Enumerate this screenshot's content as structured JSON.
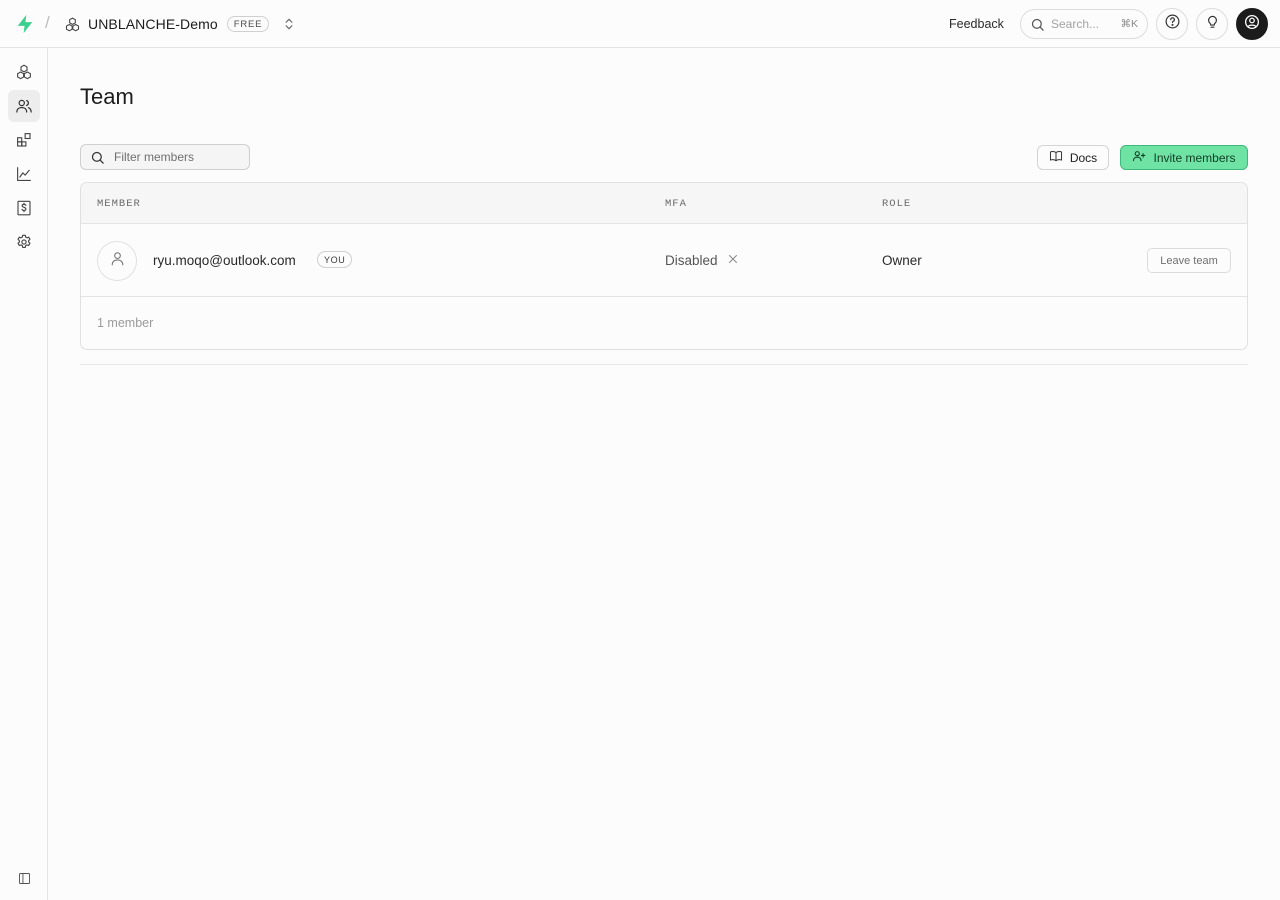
{
  "header": {
    "org_name": "UNBLANCHE-Demo",
    "plan_badge": "FREE",
    "feedback_label": "Feedback",
    "search_placeholder": "Search...",
    "search_shortcut": "⌘K",
    "icons": [
      "brand-logo-icon",
      "org-icon",
      "switch-org-icon",
      "search-icon",
      "help-icon",
      "lightbulb-icon",
      "user-avatar-icon"
    ]
  },
  "sidebar": {
    "items": [
      {
        "name": "projects",
        "icon": "boxes-icon",
        "active": false
      },
      {
        "name": "team",
        "icon": "users-icon",
        "active": true
      },
      {
        "name": "integrations",
        "icon": "blocks-icon",
        "active": false
      },
      {
        "name": "usage",
        "icon": "chart-icon",
        "active": false
      },
      {
        "name": "billing",
        "icon": "billing-icon",
        "active": false
      },
      {
        "name": "settings",
        "icon": "gear-icon",
        "active": false
      }
    ],
    "footer_icon": "sidebar-toggle-icon"
  },
  "main": {
    "title": "Team",
    "filter_placeholder": "Filter members",
    "docs_label": "Docs",
    "invite_label": "Invite members",
    "table": {
      "headers": {
        "member": "MEMBER",
        "mfa": "MFA",
        "role": "ROLE"
      },
      "rows": [
        {
          "email": "ryu.moqo@outlook.com",
          "badge": "YOU",
          "mfa": "Disabled",
          "role": "Owner",
          "action": "Leave team"
        }
      ],
      "footer": "1 member"
    }
  },
  "colors": {
    "brand_green": "#3ecf8e",
    "invite_bg": "#6fe3a3",
    "invite_border": "#3fb67b",
    "background": "#fcfcfc",
    "border": "#e4e4e4"
  }
}
